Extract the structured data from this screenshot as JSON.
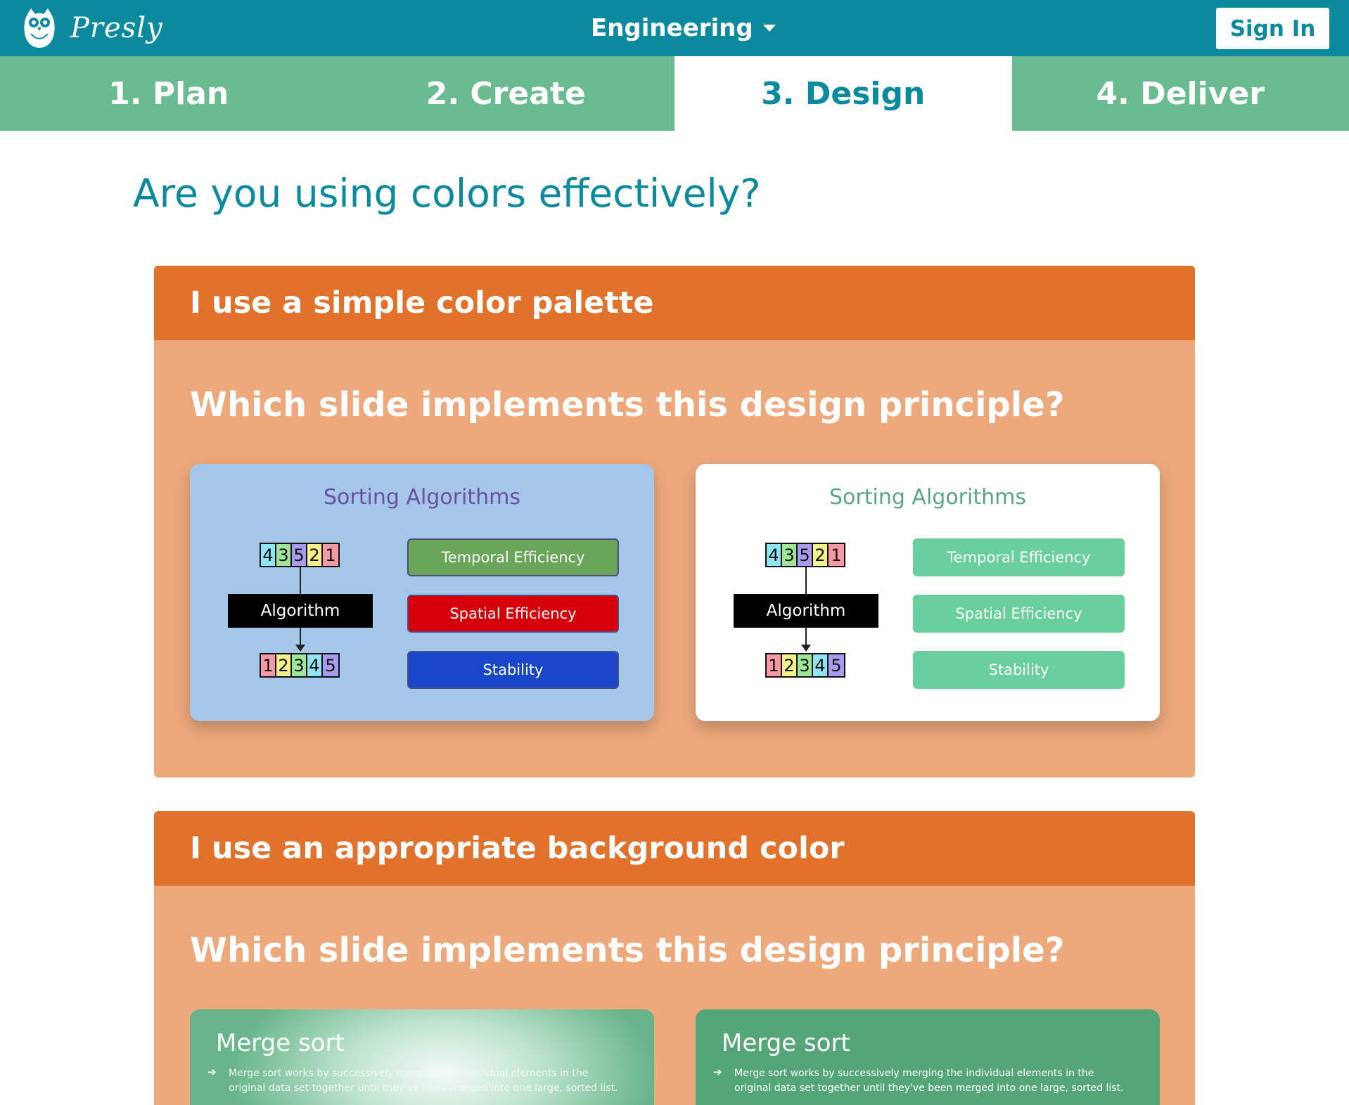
{
  "header": {
    "brand": "Presly",
    "logo_icon": "owl-icon",
    "department": "Engineering",
    "sign_in": "Sign In",
    "color": "#0b8a9e"
  },
  "steps": [
    {
      "label": "1.  Plan",
      "active": false
    },
    {
      "label": "2.  Create",
      "active": false
    },
    {
      "label": "3.  Design",
      "active": true
    },
    {
      "label": "4.  Deliver",
      "active": false
    }
  ],
  "page_title": "Are you using colors effectively?",
  "principles": [
    {
      "title": "I use a simple color palette",
      "question": "Which slide implements this design principle?",
      "options": [
        {
          "slide_title": "Sorting Algorithms",
          "input_digits": [
            "4",
            "3",
            "5",
            "2",
            "1"
          ],
          "algorithm_label": "Algorithm",
          "output_digits": [
            "1",
            "2",
            "3",
            "4",
            "5"
          ],
          "labels": [
            "Temporal Efficiency",
            "Spatial Efficiency",
            "Stability"
          ],
          "background": "#a4c6e9",
          "label_colors": [
            "#6aa65a",
            "#d5000a",
            "#1946c8"
          ]
        },
        {
          "slide_title": "Sorting Algorithms",
          "input_digits": [
            "4",
            "3",
            "5",
            "2",
            "1"
          ],
          "algorithm_label": "Algorithm",
          "output_digits": [
            "1",
            "2",
            "3",
            "4",
            "5"
          ],
          "labels": [
            "Temporal Efficiency",
            "Spatial Efficiency",
            "Stability"
          ],
          "background": "#ffffff",
          "label_colors": [
            "#69cf9c",
            "#69cf9c",
            "#69cf9c"
          ]
        }
      ]
    },
    {
      "title": "I use an appropriate background color",
      "question": "Which slide implements this design principle?",
      "options": [
        {
          "slide_title": "Merge sort",
          "bullet_icon": "arrow-right-icon",
          "bullet": "Merge sort works by successively merging the individual elements in the original data set together until they've been merged into one large, sorted list."
        },
        {
          "slide_title": "Merge sort",
          "bullet_icon": "arrow-right-icon",
          "bullet": "Merge sort works by successively merging the individual elements in the original data set together until they've been merged into one large, sorted list."
        }
      ]
    }
  ],
  "digit_colors": {
    "1": "#f59aa4",
    "2": "#f6f08a",
    "3": "#9ee69a",
    "4": "#8fe6f2",
    "5": "#a99cf0"
  },
  "colors": {
    "header_bar": "#e0722b",
    "card_body": "#eda97c",
    "tabs": "#6abb8f"
  }
}
